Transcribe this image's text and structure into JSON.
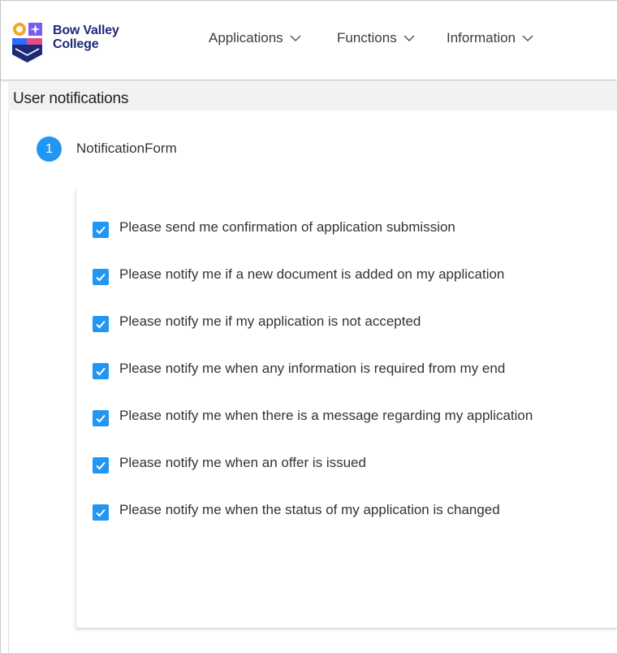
{
  "brand": {
    "name_line1": "Bow Valley",
    "name_line2": "College",
    "colors": {
      "orange": "#f5a623",
      "purple": "#7b5cf0",
      "blue": "#2f6bff",
      "navy": "#1e2a78",
      "pink": "#e94b8a"
    }
  },
  "nav": {
    "items": [
      {
        "label": "Applications",
        "icon": "chevron-down-icon"
      },
      {
        "label": "Functions",
        "icon": "chevron-down-icon"
      },
      {
        "label": "Information",
        "icon": "chevron-down-icon"
      }
    ]
  },
  "page": {
    "title": "User notifications"
  },
  "step": {
    "number": "1",
    "label": "NotificationForm"
  },
  "options": [
    {
      "label": "Please send me confirmation of application submission",
      "checked": true
    },
    {
      "label": "Please notify me if a new document is added on my application",
      "checked": true
    },
    {
      "label": "Please notify me if my application is not accepted",
      "checked": true
    },
    {
      "label": "Please notify me when any information is required from my end",
      "checked": true
    },
    {
      "label": "Please notify me when there is a message regarding my application",
      "checked": true
    },
    {
      "label": "Please notify me when an offer is issued",
      "checked": true
    },
    {
      "label": "Please notify me when the status of my application is changed",
      "checked": true
    }
  ],
  "theme": {
    "accent": "#2196f3",
    "title_bar_bg": "#f2f2f2"
  }
}
